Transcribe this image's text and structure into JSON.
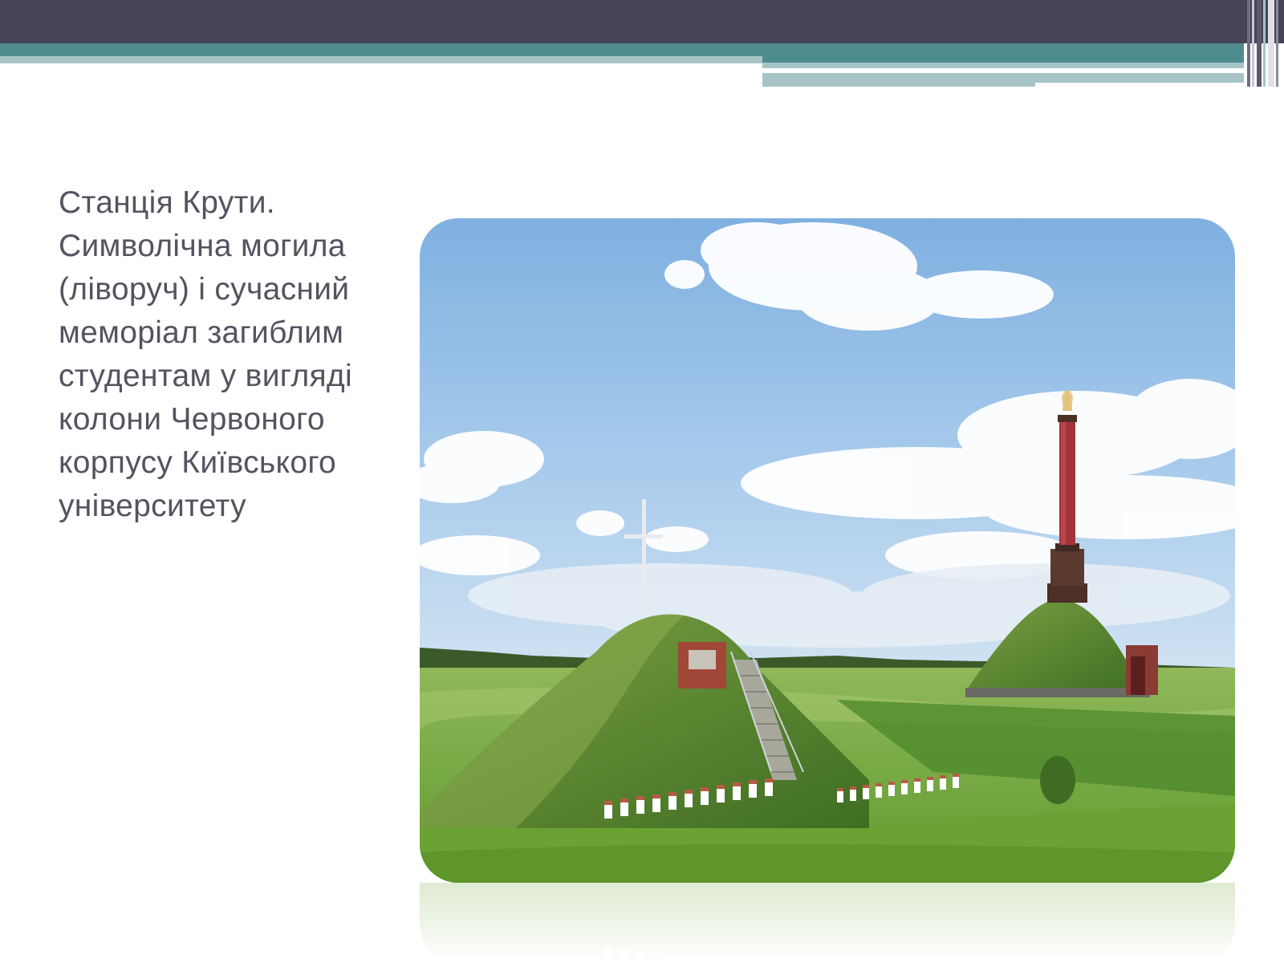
{
  "slide": {
    "caption": "Станція Крути.\nСимволічна могила\n(ліворуч) і сучасний\nмеморіал загиблим\nстудентам у вигляді\nколони Червоного\nкорпусу Київського\nуніверситету"
  },
  "theme": {
    "header_dark": "#444358",
    "header_teal": "#4f8c8e",
    "header_light": "#a6c4c6",
    "text_color": "#555360"
  }
}
